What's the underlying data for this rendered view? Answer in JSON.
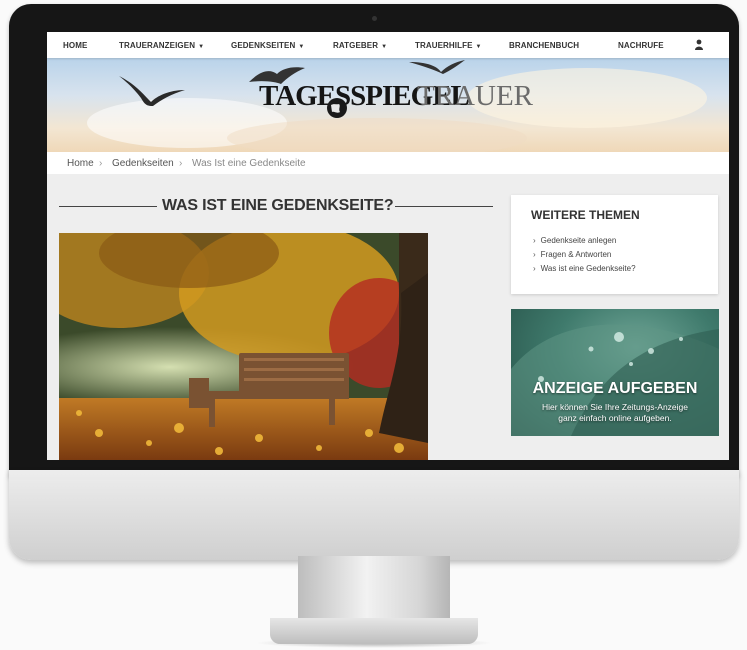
{
  "nav": {
    "items": [
      {
        "label": "HOME",
        "dropdown": false
      },
      {
        "label": "TRAUERANZEIGEN",
        "dropdown": true
      },
      {
        "label": "GEDENKSEITEN",
        "dropdown": true
      },
      {
        "label": "RATGEBER",
        "dropdown": true
      },
      {
        "label": "TRAUERHILFE",
        "dropdown": true
      },
      {
        "label": "BRANCHENBUCH",
        "dropdown": false
      },
      {
        "label": "NACHRUFE",
        "dropdown": false
      }
    ],
    "user_icon": "user-icon",
    "caret_glyph": "▼"
  },
  "header": {
    "logo_main": "TAGESSPIEGEL",
    "logo_sub": "TRAUER"
  },
  "breadcrumb": {
    "items": [
      "Home",
      "Gedenkseiten",
      "Was Ist eine Gedenkseite"
    ],
    "separator": "›"
  },
  "main": {
    "heading": "WAS IST EINE GEDENKSEITE?"
  },
  "sidebar": {
    "title": "WEITERE THEMEN",
    "links": [
      "Gedenkseite anlegen",
      "Fragen & Antworten",
      "Was ist eine Gedenkseite?"
    ]
  },
  "ad": {
    "title": "ANZEIGE AUFGEBEN",
    "line1": "Hier können Sie Ihre Zeitungs-Anzeige",
    "line2": "ganz einfach online aufgeben."
  },
  "colors": {
    "bezel": "#161616",
    "heading": "#333333",
    "ad_bg": "#3f7a6c"
  }
}
